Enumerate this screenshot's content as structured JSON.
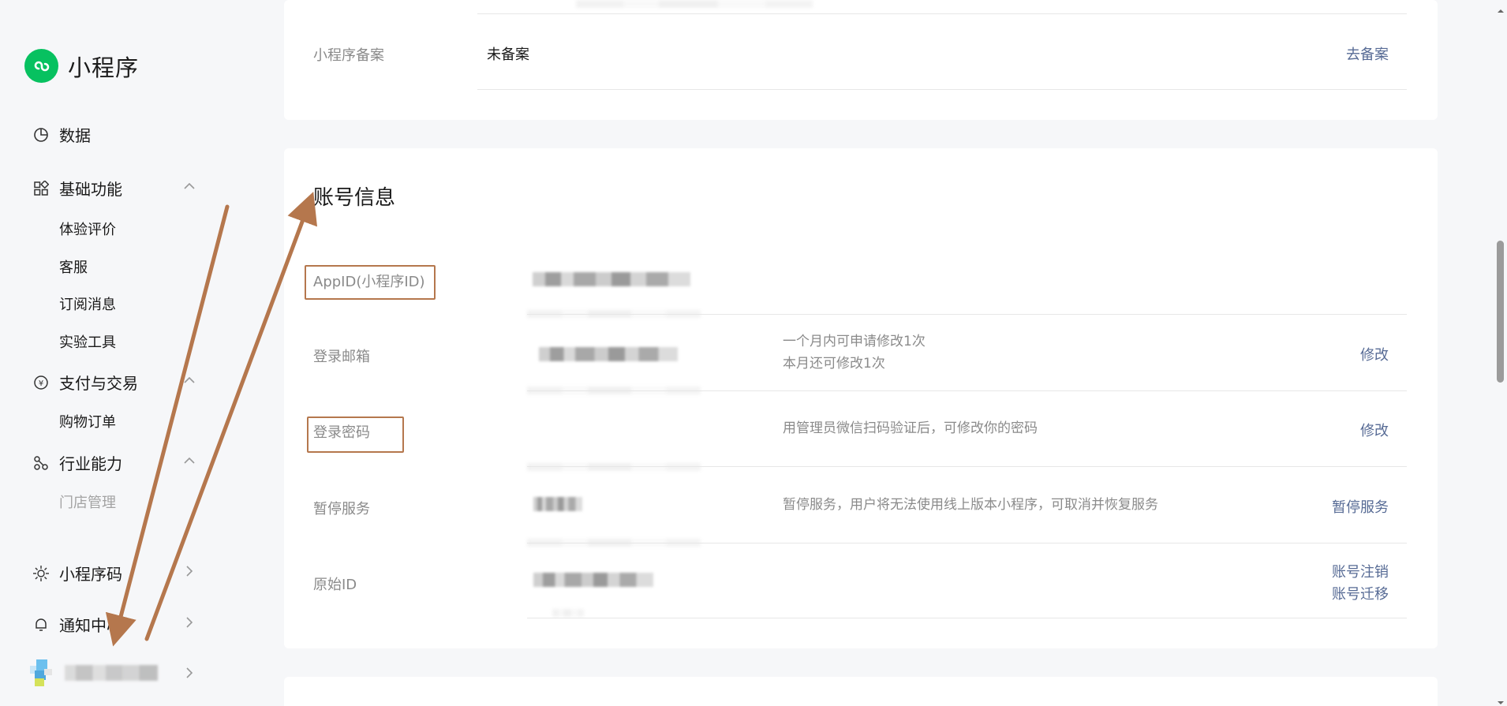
{
  "sidebar": {
    "brand": "小程序",
    "items": {
      "data": "数据",
      "basic": "基础功能",
      "basic_sub": [
        "体验评价",
        "客服",
        "订阅消息",
        "实验工具"
      ],
      "pay": "支付与交易",
      "pay_sub": [
        "购物订单"
      ],
      "industry": "行业能力",
      "industry_sub": [
        "门店管理"
      ],
      "qrcode": "小程序码",
      "notify": "通知中心"
    }
  },
  "top_card": {
    "filing_label": "小程序备案",
    "filing_value": "未备案",
    "filing_action": "去备案"
  },
  "account": {
    "title": "账号信息",
    "rows": {
      "appid": {
        "label": "AppID(小程序ID)"
      },
      "email": {
        "label": "登录邮箱",
        "desc1": "一个月内可申请修改1次",
        "desc2": "本月还可修改1次",
        "action": "修改"
      },
      "password": {
        "label": "登录密码",
        "desc": "用管理员微信扫码验证后，可修改你的密码",
        "action": "修改"
      },
      "suspend": {
        "label": "暂停服务",
        "desc": "暂停服务，用户将无法使用线上版本小程序，可取消并恢复服务",
        "action": "暂停服务"
      },
      "original": {
        "label": "原始ID",
        "action1": "账号注销",
        "action2": "账号迁移"
      }
    }
  },
  "colors": {
    "brand_green": "#07c160",
    "link": "#576b95",
    "annotation": "#b5774d"
  }
}
